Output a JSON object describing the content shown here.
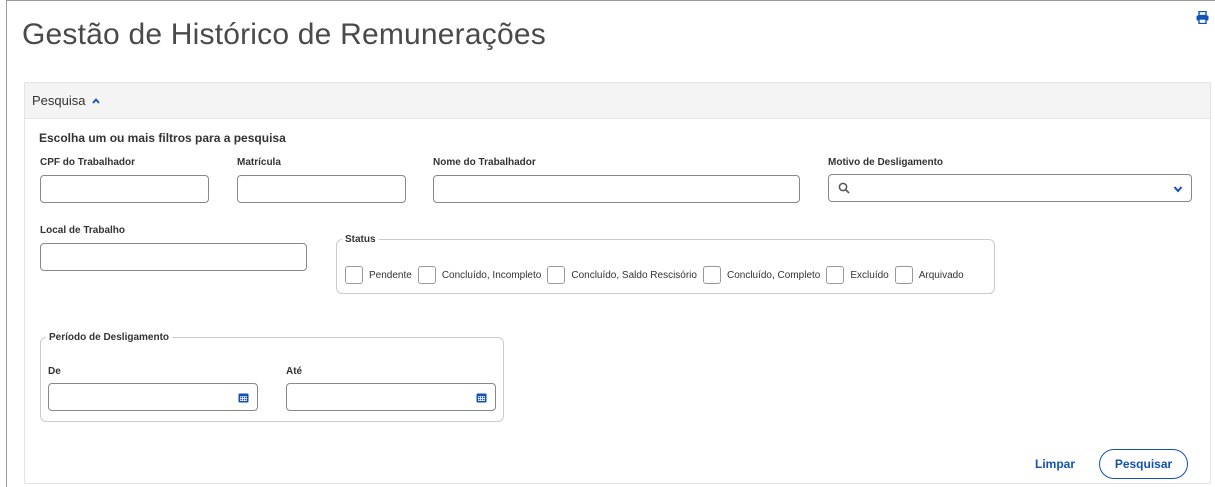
{
  "page": {
    "title": "Gestão de Histórico de Remunerações"
  },
  "icons": {
    "print": "print-icon",
    "search": "search-icon",
    "calendar": "calendar-icon",
    "chevron_up": "chevron-up-icon",
    "chevron_down": "chevron-down-icon"
  },
  "colors": {
    "primary": "#1351b4",
    "header_bg": "#f4f4f4",
    "border": "#888888"
  },
  "search_panel": {
    "header_label": "Pesquisa",
    "hint": "Escolha um ou mais filtros para a pesquisa",
    "fields": {
      "cpf": {
        "label": "CPF do Trabalhador",
        "value": ""
      },
      "matricula": {
        "label": "Matrícula",
        "value": ""
      },
      "nome": {
        "label": "Nome do Trabalhador",
        "value": ""
      },
      "motivo": {
        "label": "Motivo de Desligamento",
        "value": ""
      },
      "local": {
        "label": "Local de Trabalho",
        "value": ""
      }
    },
    "status": {
      "legend": "Status",
      "options": [
        {
          "label": "Pendente",
          "checked": false
        },
        {
          "label": "Concluído, Incompleto",
          "checked": false
        },
        {
          "label": "Concluído, Saldo Rescisório",
          "checked": false
        },
        {
          "label": "Concluído, Completo",
          "checked": false
        },
        {
          "label": "Excluído",
          "checked": false
        },
        {
          "label": "Arquivado",
          "checked": false
        }
      ]
    },
    "periodo": {
      "legend": "Período de Desligamento",
      "de": {
        "label": "De",
        "value": ""
      },
      "ate": {
        "label": "Até",
        "value": ""
      }
    },
    "actions": {
      "clear_label": "Limpar",
      "search_label": "Pesquisar"
    }
  }
}
